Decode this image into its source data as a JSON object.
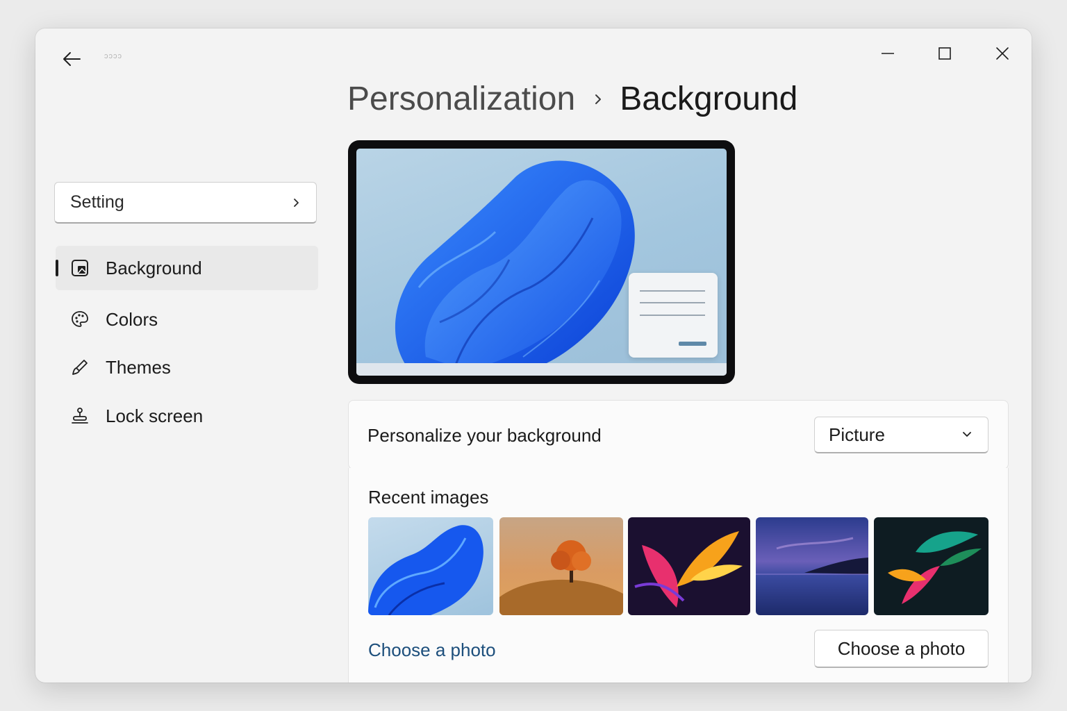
{
  "window": {
    "app_title": "ɔɔɔɔ"
  },
  "titlebar": {
    "back_icon": "arrow-left-icon",
    "minimize_icon": "minimize-icon",
    "maximize_icon": "maximize-icon",
    "close_icon": "close-icon"
  },
  "breadcrumb": {
    "parent": "Personalization",
    "separator_icon": "chevron-right-icon",
    "current": "Background"
  },
  "sidebar": {
    "search": {
      "label": "Setting",
      "icon": "chevron-right-icon"
    },
    "items": [
      {
        "label": "Background",
        "icon": "picture-icon",
        "selected": true
      },
      {
        "label": "Colors",
        "icon": "palette-icon",
        "selected": false
      },
      {
        "label": "Themes",
        "icon": "brush-icon",
        "selected": false
      },
      {
        "label": "Lock screen",
        "icon": "lock-screen-icon",
        "selected": false
      }
    ]
  },
  "background_settings": {
    "personalize_label": "Personalize your background",
    "background_type": "Picture",
    "recent_images_title": "Recent images",
    "recent_images": [
      {
        "name": "windows-bloom-blue"
      },
      {
        "name": "autumn-tree-on-hill"
      },
      {
        "name": "abstract-colorful-petals"
      },
      {
        "name": "twilight-lake"
      },
      {
        "name": "abstract-birds-dark"
      }
    ],
    "choose_photo_link": "Choose a photo",
    "choose_photo_button": "Choose a photo"
  },
  "colors": {
    "accent": "#0067c0",
    "link": "#1d4f7c",
    "window_bg": "#f3f3f3",
    "card_bg": "#fbfbfb"
  }
}
